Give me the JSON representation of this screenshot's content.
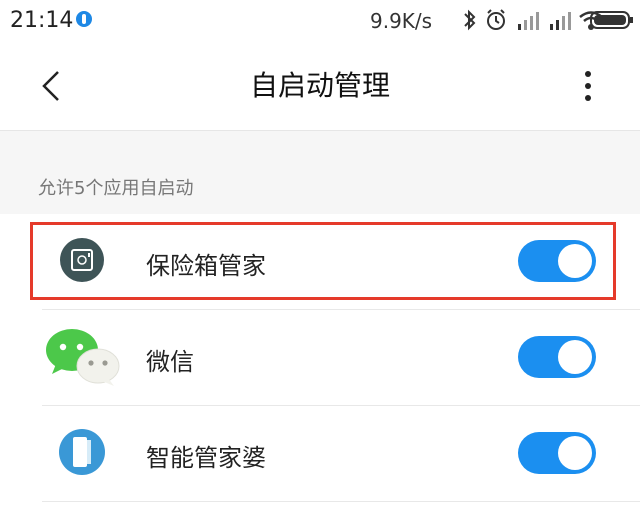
{
  "status_bar": {
    "time": "21:14",
    "network_speed": "9.9K/s",
    "icons": [
      "notification-badge-icon",
      "bluetooth-icon",
      "alarm-icon",
      "signal-icon",
      "signal-icon",
      "wifi-icon",
      "battery-icon"
    ]
  },
  "header": {
    "title": "自启动管理",
    "back_icon": "chevron-left-icon",
    "more_icon": "more-vert-icon"
  },
  "section": {
    "label": "允许5个应用自启动"
  },
  "apps": [
    {
      "name": "保险箱管家",
      "icon": "safe-icon",
      "autostart": true,
      "highlighted": true
    },
    {
      "name": "微信",
      "icon": "wechat-icon",
      "autostart": true,
      "highlighted": false
    },
    {
      "name": "智能管家婆",
      "icon": "door-icon",
      "autostart": true,
      "highlighted": false
    }
  ],
  "colors": {
    "toggle_on": "#1b8ff0",
    "highlight": "#e53a2a",
    "wechat_green": "#4cc84a",
    "safe_icon_bg": "#3e5457",
    "door_icon_blue": "#3a98d6"
  }
}
